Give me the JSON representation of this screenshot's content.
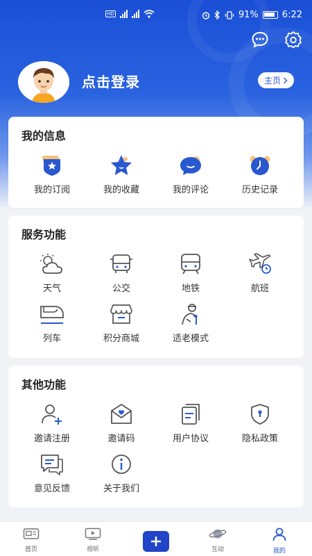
{
  "status": {
    "battery": "91%",
    "time": "6:22"
  },
  "header": {
    "login_text": "点击登录",
    "home_button": "主页"
  },
  "my_info": {
    "title": "我的信息",
    "items": [
      {
        "label": "我的订阅",
        "icon": "subscription-icon"
      },
      {
        "label": "我的收藏",
        "icon": "star-icon"
      },
      {
        "label": "我的评论",
        "icon": "comment-icon"
      },
      {
        "label": "历史记录",
        "icon": "history-icon"
      }
    ]
  },
  "services": {
    "title": "服务功能",
    "items": [
      {
        "label": "天气",
        "icon": "weather-icon"
      },
      {
        "label": "公交",
        "icon": "bus-icon"
      },
      {
        "label": "地铁",
        "icon": "subway-icon"
      },
      {
        "label": "航班",
        "icon": "flight-icon"
      },
      {
        "label": "列车",
        "icon": "train-icon"
      },
      {
        "label": "积分商城",
        "icon": "points-mall-icon"
      },
      {
        "label": "适老模式",
        "icon": "elderly-mode-icon"
      }
    ]
  },
  "others": {
    "title": "其他功能",
    "items": [
      {
        "label": "邀请注册",
        "icon": "invite-register-icon"
      },
      {
        "label": "邀请码",
        "icon": "invite-code-icon"
      },
      {
        "label": "用户协议",
        "icon": "user-agreement-icon"
      },
      {
        "label": "隐私政策",
        "icon": "privacy-policy-icon"
      },
      {
        "label": "意见反馈",
        "icon": "feedback-icon"
      },
      {
        "label": "关于我们",
        "icon": "about-icon"
      }
    ]
  },
  "tabbar": {
    "items": [
      {
        "label": "首页",
        "icon": "home-icon"
      },
      {
        "label": "视听",
        "icon": "video-icon"
      },
      {
        "label": "",
        "icon": "plus-icon"
      },
      {
        "label": "互动",
        "icon": "planet-icon"
      },
      {
        "label": "我的",
        "icon": "user-icon"
      }
    ],
    "active_index": 4
  },
  "colors": {
    "brand_blue": "#2a58d0",
    "accent_orange": "#f5a623"
  }
}
